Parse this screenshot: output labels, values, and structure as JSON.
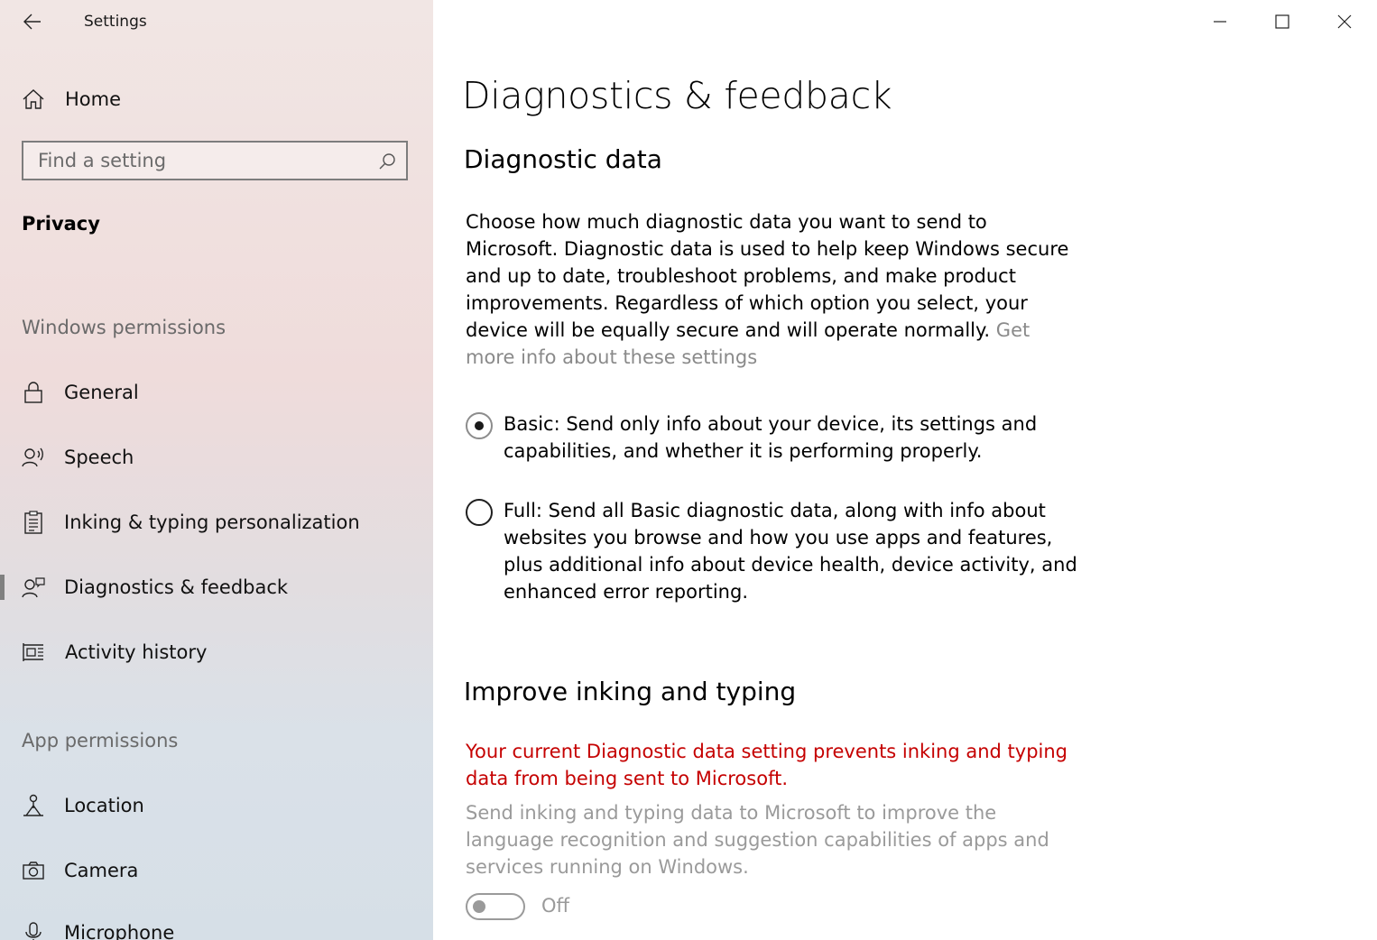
{
  "window": {
    "app_title": "Settings"
  },
  "sidebar": {
    "home_label": "Home",
    "search_placeholder": "Find a setting",
    "section_title": "Privacy",
    "windows_permissions_header": "Windows permissions",
    "app_permissions_header": "App permissions",
    "windows_items": [
      {
        "label": "General",
        "icon": "lock-icon"
      },
      {
        "label": "Speech",
        "icon": "speech-icon"
      },
      {
        "label": "Inking & typing personalization",
        "icon": "clipboard-icon"
      },
      {
        "label": "Diagnostics & feedback",
        "icon": "diagnostics-icon",
        "selected": true
      },
      {
        "label": "Activity history",
        "icon": "activity-icon"
      }
    ],
    "app_items": [
      {
        "label": "Location",
        "icon": "location-icon"
      },
      {
        "label": "Camera",
        "icon": "camera-icon"
      },
      {
        "label": "Microphone",
        "icon": "microphone-icon"
      }
    ]
  },
  "main": {
    "page_title": "Diagnostics & feedback",
    "diagnostic_data": {
      "heading": "Diagnostic data",
      "description": "Choose how much diagnostic data you want to send to Microsoft. Diagnostic data is used to help keep Windows secure and up to date, troubleshoot problems, and make product improvements. Regardless of which option you select, your device will be equally secure and will operate normally.",
      "link": "Get more info about these settings",
      "options": [
        {
          "label": "Basic: Send only info about your device, its settings and capabilities, and whether it is performing properly.",
          "checked": true
        },
        {
          "label": "Full: Send all Basic diagnostic data, along with info about websites you browse and how you use apps and features, plus additional info about device health, device activity, and enhanced error reporting.",
          "checked": false
        }
      ]
    },
    "inking": {
      "heading": "Improve inking and typing",
      "warning": "Your current Diagnostic data setting prevents inking and typing data from being sent to Microsoft.",
      "description": "Send inking and typing data to Microsoft to improve the language recognition and suggestion capabilities of apps and services running on Windows.",
      "toggle_state": "Off"
    }
  },
  "colors": {
    "warning": "#c50000",
    "disabled_text": "#9a9a9a",
    "link": "#8a8a8a"
  }
}
